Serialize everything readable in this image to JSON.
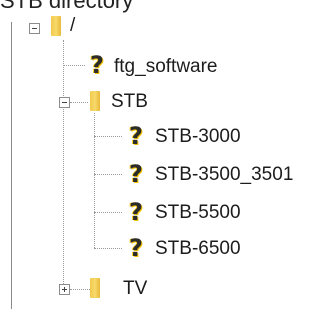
{
  "title": "STB directory",
  "tree": {
    "root": {
      "label": "/",
      "expanded": true,
      "icon": "folder-icon",
      "children": [
        {
          "label": "ftg_software",
          "icon": "question-mark-icon"
        },
        {
          "label": "STB",
          "expanded": true,
          "icon": "folder-icon",
          "children": [
            {
              "label": "STB-3000",
              "icon": "question-mark-icon"
            },
            {
              "label": "STB-3500_3501",
              "icon": "question-mark-icon"
            },
            {
              "label": "STB-5500",
              "icon": "question-mark-icon"
            },
            {
              "label": "STB-6500",
              "icon": "question-mark-icon"
            }
          ]
        },
        {
          "label": "TV",
          "expanded": false,
          "icon": "folder-icon"
        }
      ]
    }
  },
  "colors": {
    "folder": "#f2c94c",
    "question_mark_glow": "#f2c200",
    "tree_lines": "#9a9a9a"
  }
}
